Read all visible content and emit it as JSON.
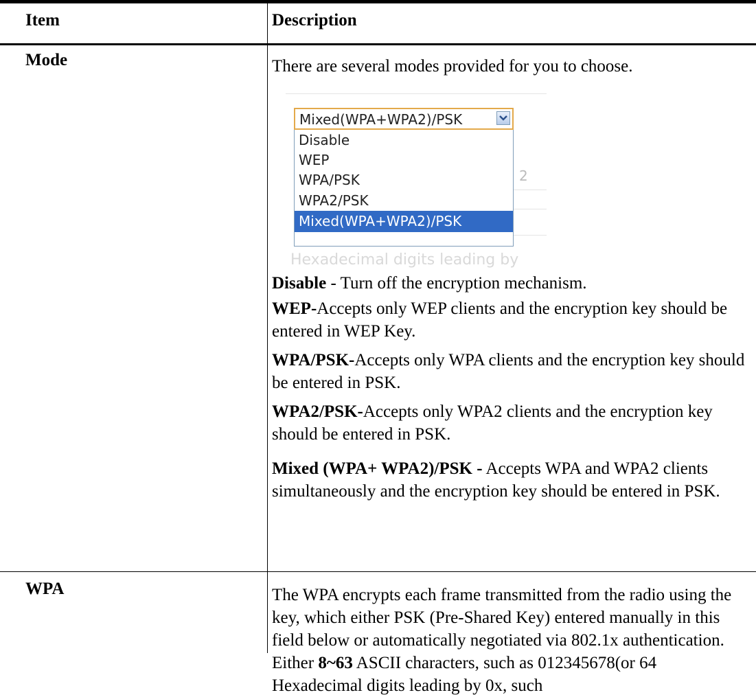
{
  "table": {
    "header": {
      "item": "Item",
      "description": "Description"
    },
    "rows": [
      {
        "item": "Mode",
        "intro": "There are several modes provided for you to choose.",
        "screenshot": {
          "select_value": "Mixed(WPA+WPA2)/PSK",
          "options": [
            "Disable",
            "WEP",
            "WPA/PSK",
            "WPA2/PSK",
            "Mixed(WPA+WPA2)/PSK"
          ],
          "selected_index": 4,
          "ghost_right_text": "2",
          "ghost_bottom_text": "4 Hexadecimal digits leading by",
          "arrow_icon": "chevron-down-icon"
        },
        "definitions": [
          {
            "term": "Disable",
            "sep": " - ",
            "text": "Turn off the encryption mechanism."
          },
          {
            "term": "WEP-",
            "sep": "",
            "text": "Accepts only WEP clients and the encryption key should be entered in WEP Key."
          },
          {
            "term": "WPA/PSK-",
            "sep": "",
            "text": "Accepts only WPA clients and the encryption key should be entered in PSK."
          },
          {
            "term": "WPA2/PSK-",
            "sep": "",
            "text": "Accepts only WPA2 clients and the encryption key should be entered in PSK."
          },
          {
            "term": "Mixed (WPA+ WPA2)/PSK -",
            "sep": " ",
            "text": "Accepts WPA and WPA2 clients simultaneously and the encryption key should be entered in PSK."
          }
        ]
      },
      {
        "item": "WPA",
        "text_before": "The WPA encrypts each frame transmitted from the radio using the key, which either PSK (Pre-Shared Key) entered manually in this field below or automatically negotiated via 802.1x authentication. Either ",
        "bold": "8~63",
        "text_after": " ASCII characters, such as 012345678(or 64 Hexadecimal digits leading by 0x, such"
      }
    ]
  },
  "colors": {
    "selected_option_bg": "#316ac5",
    "select_focus_border": "#e3a94a"
  }
}
